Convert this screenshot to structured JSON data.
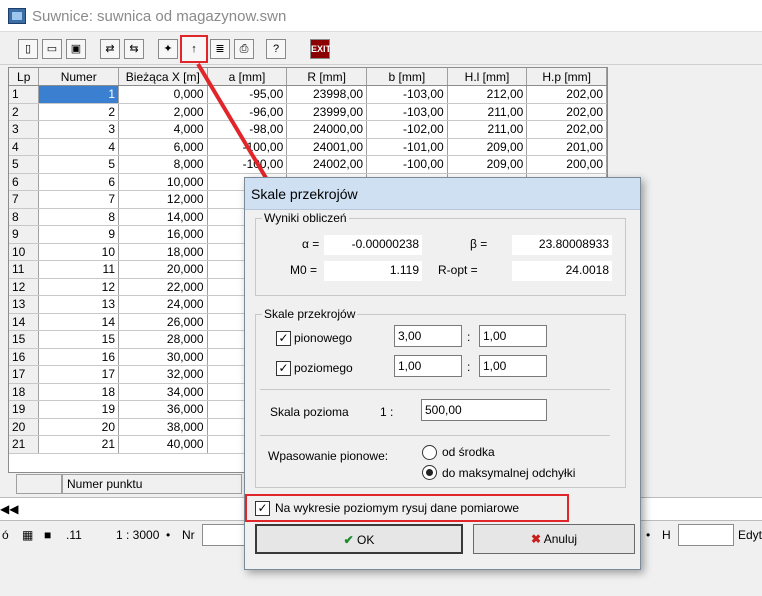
{
  "window": {
    "title": "Suwnice: suwnica od magazynow.swn"
  },
  "toolbar": [
    "new",
    "open",
    "save",
    "import",
    "export",
    "help-bulb",
    "scale",
    "list",
    "print",
    "help",
    "exit"
  ],
  "grid": {
    "headers": [
      "Lp",
      "Numer",
      "Bieżąca X [m]",
      "a [mm]",
      "R [mm]",
      "b [mm]",
      "H.l [mm]",
      "H.p [mm]"
    ],
    "rows": [
      [
        "1",
        "1",
        "0,000",
        "-95,00",
        "23998,00",
        "-103,00",
        "212,00",
        "202,00"
      ],
      [
        "2",
        "2",
        "2,000",
        "-96,00",
        "23999,00",
        "-103,00",
        "211,00",
        "202,00"
      ],
      [
        "3",
        "3",
        "4,000",
        "-98,00",
        "24000,00",
        "-102,00",
        "211,00",
        "202,00"
      ],
      [
        "4",
        "4",
        "6,000",
        "-100,00",
        "24001,00",
        "-101,00",
        "209,00",
        "201,00"
      ],
      [
        "5",
        "5",
        "8,000",
        "-100,00",
        "24002,00",
        "-100,00",
        "209,00",
        "200,00"
      ],
      [
        "6",
        "6",
        "10,000",
        "",
        "",
        "",
        "",
        ""
      ],
      [
        "7",
        "7",
        "12,000",
        "",
        "",
        "",
        "",
        ""
      ],
      [
        "8",
        "8",
        "14,000",
        "",
        "",
        "",
        "",
        ""
      ],
      [
        "9",
        "9",
        "16,000",
        "",
        "",
        "",
        "",
        ""
      ],
      [
        "10",
        "10",
        "18,000",
        "",
        "",
        "",
        "",
        ""
      ],
      [
        "11",
        "11",
        "20,000",
        "",
        "",
        "",
        "",
        ""
      ],
      [
        "12",
        "12",
        "22,000",
        "",
        "",
        "",
        "",
        ""
      ],
      [
        "13",
        "13",
        "24,000",
        "",
        "",
        "",
        "",
        ""
      ],
      [
        "14",
        "14",
        "26,000",
        "",
        "",
        "",
        "",
        ""
      ],
      [
        "15",
        "15",
        "28,000",
        "",
        "",
        "",
        "",
        ""
      ],
      [
        "16",
        "16",
        "30,000",
        "",
        "",
        "",
        "",
        ""
      ],
      [
        "17",
        "17",
        "32,000",
        "",
        "",
        "",
        "",
        ""
      ],
      [
        "18",
        "18",
        "34,000",
        "",
        "",
        "",
        "",
        ""
      ],
      [
        "19",
        "19",
        "36,000",
        "",
        "",
        "",
        "",
        ""
      ],
      [
        "20",
        "20",
        "38,000",
        "",
        "",
        "",
        "",
        ""
      ],
      [
        "21",
        "21",
        "40,000",
        "",
        "",
        "",
        "",
        ""
      ]
    ],
    "status_label": "Numer punktu"
  },
  "bottom": {
    "scale": "1 : 3000",
    "nr_label": "Nr",
    "h_label": "H",
    "edit_label": "Edyt",
    "dot_label": ".11"
  },
  "dialog": {
    "title": "Skale przekrojów",
    "results": {
      "group_label": "Wyniki obliczeń",
      "alpha_label": "α =",
      "alpha_value": "-0.00000238",
      "beta_label": "β =",
      "beta_value": "23.80008933",
      "m0_label": "M0 =",
      "m0_value": "1.119",
      "ropt_label": "R-opt =",
      "ropt_value": "24.0018"
    },
    "scales": {
      "group_label": "Skale przekrojów",
      "vertical_label": "pionowego",
      "vertical_a": "3,00",
      "vertical_b": "1,00",
      "horizontal_label": "poziomego",
      "horizontal_a": "1,00",
      "horizontal_b": "1,00",
      "colon": ":",
      "horizontal_scale_label": "Skala pozioma",
      "one_colon": "1 :",
      "horizontal_scale_value": "500,00",
      "fit_label": "Wpasowanie pionowe:",
      "fit_center": "od środka",
      "fit_max": "do maksymalnej odchyłki"
    },
    "draw_measured_label": "Na wykresie poziomym rysuj dane pomiarowe",
    "ok_label": "OK",
    "cancel_label": "Anuluj"
  }
}
